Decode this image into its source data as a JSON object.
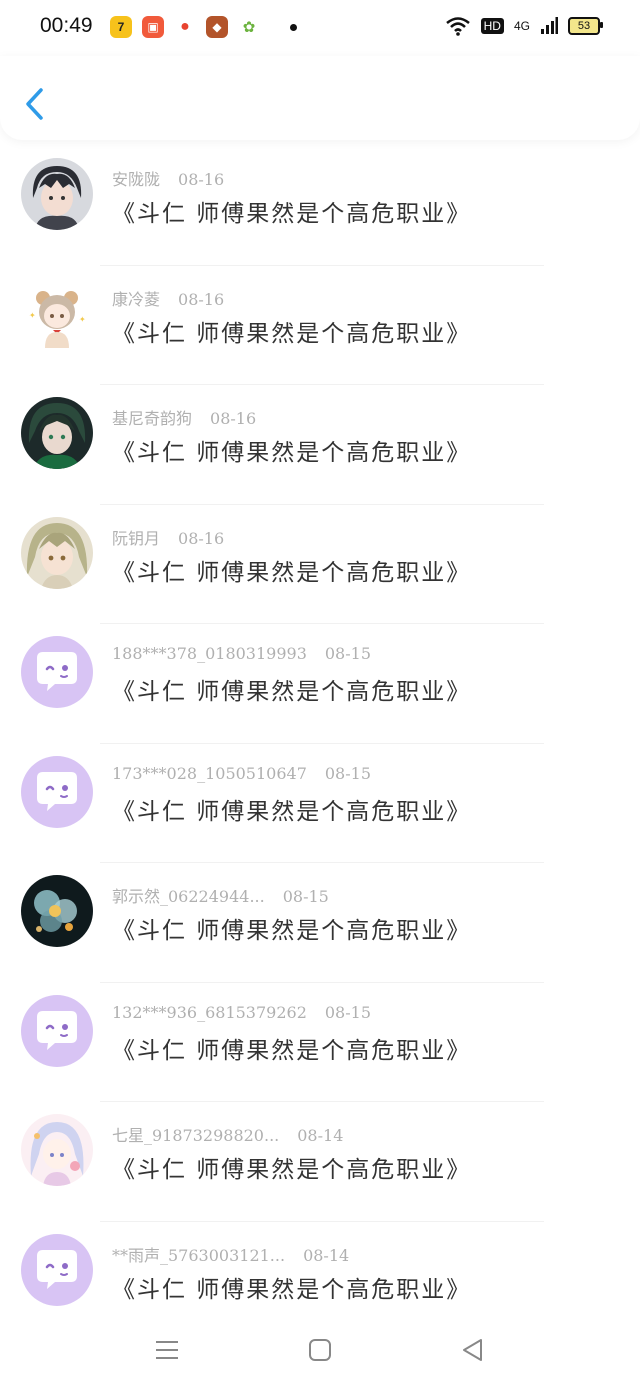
{
  "status_bar": {
    "time": "00:49",
    "hd": "HD",
    "network": "4G",
    "battery": "53"
  },
  "header": {
    "back_icon": "chevron-left-icon",
    "accent": "#2f9be8"
  },
  "comments": [
    {
      "name": "安陇陇",
      "date": "08-16",
      "text": "《斗仁 师傅果然是个高危职业》",
      "avatar": "anime-boy-dark-hair"
    },
    {
      "name": "康冷菱",
      "date": "08-16",
      "text": "《斗仁 师傅果然是个高危职业》",
      "avatar": "chibi-bear-girl"
    },
    {
      "name": "基尼奇韵狗",
      "date": "08-16",
      "text": "《斗仁 师傅果然是个高危职业》",
      "avatar": "anime-green-boy"
    },
    {
      "name": "阮钥月",
      "date": "08-16",
      "text": "《斗仁 师傅果然是个高危职业》",
      "avatar": "anime-blonde-girl"
    },
    {
      "name": "188***378_0180319993",
      "date": "08-15",
      "text": "《斗仁 师傅果然是个高危职业》",
      "avatar": "default-chat-bubble"
    },
    {
      "name": "173***028_1050510647",
      "date": "08-15",
      "text": "《斗仁 师傅果然是个高危职业》",
      "avatar": "default-chat-bubble"
    },
    {
      "name": "郭示然_06224944...",
      "date": "08-15",
      "text": "《斗仁 师傅果然是个高危职业》",
      "avatar": "glowing-flowers"
    },
    {
      "name": "132***936_6815379262",
      "date": "08-15",
      "text": "《斗仁 师傅果然是个高危职业》",
      "avatar": "default-chat-bubble"
    },
    {
      "name": "七星_91873298820...",
      "date": "08-14",
      "text": "《斗仁 师傅果然是个高危职业》",
      "avatar": "anime-white-hair-girl"
    },
    {
      "name": "**雨声_5763003121...",
      "date": "08-14",
      "text": "《斗仁 师傅果然是个高危职业》",
      "avatar": "default-chat-bubble"
    }
  ],
  "colors": {
    "default_avatar_bg": "#d8c4f4",
    "meta_text": "#b0b0b0",
    "comment_text": "#333333"
  },
  "navbar": {
    "menu_icon": "menu-icon",
    "home_icon": "home-square-icon",
    "back_icon": "back-triangle-icon"
  }
}
